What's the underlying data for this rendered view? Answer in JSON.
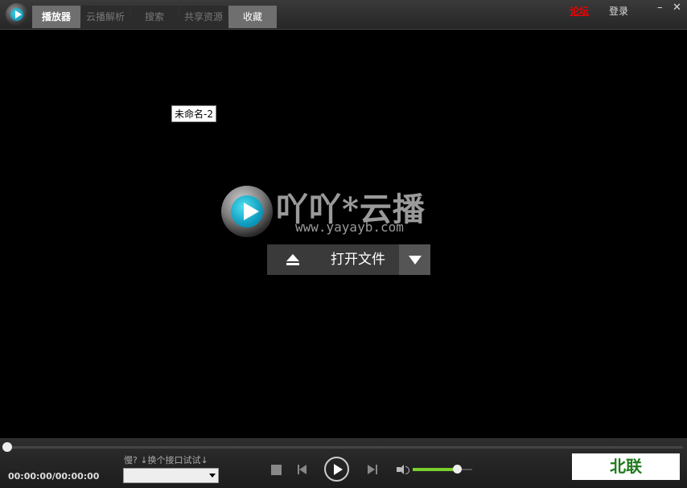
{
  "topbar": {
    "tabs": [
      {
        "label": "播放器"
      },
      {
        "label": "云播解析"
      },
      {
        "label": "搜索"
      },
      {
        "label": "共享资源"
      },
      {
        "label": "收藏"
      }
    ],
    "forum_link": "论坛",
    "login_link": "登录",
    "minimize": "–",
    "close": "✕"
  },
  "video": {
    "file_name": "未命名-2",
    "brand_title": "吖吖*云播",
    "brand_url": "www.yayayb.com",
    "open_file": "打开文件"
  },
  "controls": {
    "time": "00:00:00/00:00:00",
    "hint": "慢? ↓换个接口试试↓",
    "interface_select": "",
    "progress": 0,
    "volume": 0.75
  },
  "ad": {
    "text": "北联"
  },
  "colors": {
    "accent_green": "#7bd02b",
    "forum_red": "#e00000",
    "ad_green": "#1f7a1f"
  }
}
